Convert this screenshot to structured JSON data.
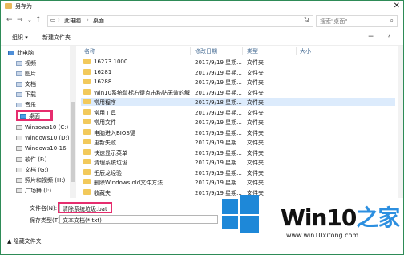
{
  "window": {
    "title": "另存为",
    "close_glyph": "✕"
  },
  "address": {
    "path": [
      "此电脑",
      "桌面"
    ],
    "search_placeholder": "搜索\"桌面\""
  },
  "toolbar": {
    "organize": "组织 ▾",
    "new_folder": "新建文件夹"
  },
  "nav": {
    "items": [
      {
        "label": "此电脑",
        "icon": "pc"
      },
      {
        "label": "视频",
        "icon": "folder"
      },
      {
        "label": "图片",
        "icon": "folder"
      },
      {
        "label": "文档",
        "icon": "folder"
      },
      {
        "label": "下载",
        "icon": "folder"
      },
      {
        "label": "音乐",
        "icon": "folder"
      },
      {
        "label": "桌面",
        "icon": "desktop"
      },
      {
        "label": "Winsows10 (C:)",
        "icon": "drive"
      },
      {
        "label": "Windows10 (D:)",
        "icon": "drive"
      },
      {
        "label": "Windows10-16",
        "icon": "drive"
      },
      {
        "label": "软件 (F:)",
        "icon": "drive"
      },
      {
        "label": "文档 (G:)",
        "icon": "drive"
      },
      {
        "label": "照片和视频 (H:)",
        "icon": "drive"
      },
      {
        "label": "广场舞 (I:)",
        "icon": "drive"
      },
      {
        "label": "...",
        "icon": "drive"
      }
    ]
  },
  "columns": {
    "name": "名称",
    "date": "修改日期",
    "type": "类型",
    "size": "大小"
  },
  "files": [
    {
      "name": "16273.1000",
      "date": "2017/9/19 星期...",
      "type": "文件夹"
    },
    {
      "name": "16281",
      "date": "2017/9/19 星期...",
      "type": "文件夹"
    },
    {
      "name": "16288",
      "date": "2017/9/19 星期...",
      "type": "文件夹"
    },
    {
      "name": "Win10系统鼠标右键点击粘贴无效的解决...",
      "date": "2017/9/19 星期...",
      "type": "文件夹"
    },
    {
      "name": "常用程序",
      "date": "2017/9/18 星期...",
      "type": "文件夹"
    },
    {
      "name": "常用工具",
      "date": "2017/9/19 星期...",
      "type": "文件夹"
    },
    {
      "name": "常用文件",
      "date": "2017/9/19 星期...",
      "type": "文件夹"
    },
    {
      "name": "电脑进入BIOS键",
      "date": "2017/9/19 星期...",
      "type": "文件夹"
    },
    {
      "name": "更新失败",
      "date": "2017/9/19 星期...",
      "type": "文件夹"
    },
    {
      "name": "快速显示菜单",
      "date": "2017/9/19 星期...",
      "type": "文件夹"
    },
    {
      "name": "清理系统垃圾",
      "date": "2017/9/19 星期...",
      "type": "文件夹"
    },
    {
      "name": "壬辰龙经验",
      "date": "2017/9/19 星期...",
      "type": "文件夹"
    },
    {
      "name": "删除Windows.old文件方法",
      "date": "2017/9/19 星期...",
      "type": "文件夹"
    },
    {
      "name": "收藏夹",
      "date": "2017/9/19 星期...",
      "type": "文件夹"
    },
    {
      "name": "数据恢复",
      "date": "2017/9/19 星期...",
      "type": "文件夹"
    }
  ],
  "save": {
    "filename_label": "文件名(N):",
    "filename_value": "清除系统垃圾.bat",
    "type_label": "保存类型(T):",
    "type_value": "文本文档(*.txt)",
    "hide_folders": "▲ 隐藏文件夹"
  },
  "watermark": {
    "brand_a": "Win10",
    "brand_b": "之家",
    "url": "www.win10xitong.com",
    "brand_color": "#1e88d8",
    "accent_color": "#2c8fe0"
  }
}
